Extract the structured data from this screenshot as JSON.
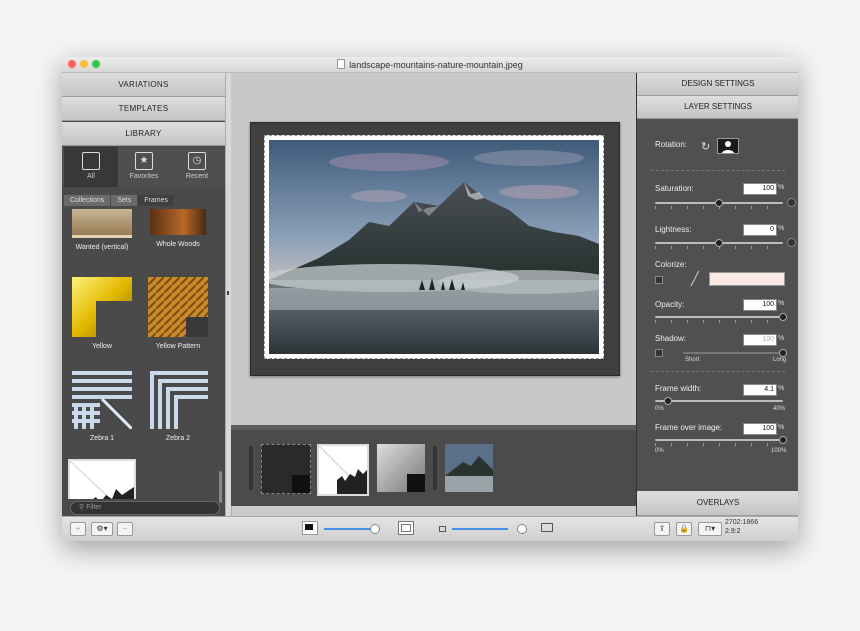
{
  "window": {
    "title": "landscape-mountains-nature-mountain.jpeg"
  },
  "left_panel": {
    "sections": [
      "VARIATIONS",
      "TEMPLATES",
      "LIBRARY"
    ],
    "library_tabs": [
      {
        "label": "All",
        "icon": "square-icon"
      },
      {
        "label": "Favorites",
        "icon": "star-icon"
      },
      {
        "label": "Recent",
        "icon": "clock-icon"
      }
    ],
    "breadcrumbs": [
      "Collections",
      "Sets",
      "Frames"
    ],
    "frames": [
      "Wanted (vertical)",
      "Whole Woods",
      "Yellow",
      "Yellow Pattern",
      "Zebra 1",
      "Zebra 2"
    ],
    "filter_placeholder": "Filter"
  },
  "right_panel": {
    "design_settings": "DESIGN SETTINGS",
    "layer_settings": "LAYER SETTINGS",
    "overlays": "OVERLAYS",
    "rotation_label": "Rotation:",
    "saturation": {
      "label": "Saturation:",
      "value": "100",
      "unit": "%",
      "level": 0.5
    },
    "lightness": {
      "label": "Lightness:",
      "value": "0",
      "unit": "%",
      "level": 0.5
    },
    "colorize": {
      "label": "Colorize:",
      "swatch": "#fde9e4"
    },
    "opacity": {
      "label": "Opacity:",
      "value": "100",
      "unit": "%",
      "level": 1.0
    },
    "shadow": {
      "label": "Shadow:",
      "value": "100",
      "unit": "%",
      "short": "Short",
      "long": "Long",
      "level": 1.0
    },
    "frame_width": {
      "label": "Frame width:",
      "value": "4.1",
      "unit": "%",
      "min": "0%",
      "max": "40%",
      "level": 0.1
    },
    "frame_over_image": {
      "label": "Frame over image:",
      "value": "100",
      "unit": "%",
      "min": "0%",
      "max": "100%",
      "level": 1.0
    }
  },
  "bottom_bar": {
    "dimensions": "2702:1866",
    "ratio": "2.9:2"
  },
  "colors": {
    "accent": "#4a90e2",
    "panel": "#4a4a4a"
  }
}
